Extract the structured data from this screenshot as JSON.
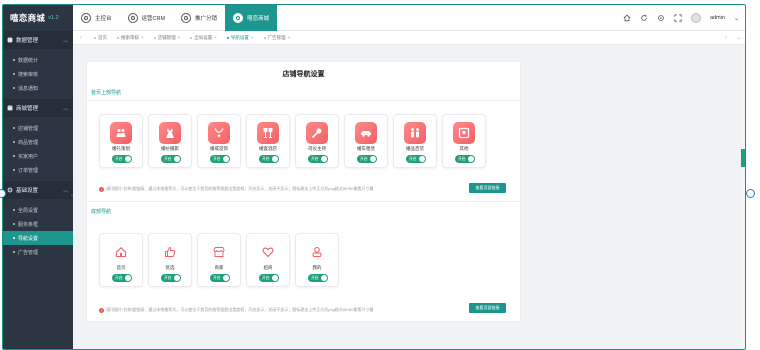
{
  "app": {
    "name": "嘻恋商城",
    "version": "v1.2"
  },
  "sidebar": {
    "groups": [
      {
        "label": "数据管理",
        "icon": "database-icon",
        "items": [
          "数据统计",
          "搜索审核",
          "消息通知"
        ]
      },
      {
        "label": "商城管理",
        "icon": "store-icon",
        "items": [
          "店铺管理",
          "商品管理",
          "买家用户",
          "订单管理"
        ]
      },
      {
        "label": "基础设置",
        "icon": "gear-icon",
        "items": [
          "全局设置",
          "服务条框",
          "导航设置",
          "广告管理"
        ]
      }
    ],
    "active_item": "导航设置"
  },
  "topbar": {
    "tabs": [
      {
        "label": "主控台",
        "active": false
      },
      {
        "label": "运营CRM",
        "active": false
      },
      {
        "label": "推广分销",
        "active": false
      },
      {
        "label": "嘻恋商城",
        "active": true
      }
    ],
    "icons": [
      "home-icon",
      "refresh-icon",
      "settings-icon",
      "fullscreen-icon"
    ],
    "user": "admin",
    "user_chevron": "⌄"
  },
  "crumbs": {
    "left_arrow": "‹",
    "right_arrow": "›",
    "more_arrow": "⌄",
    "items": [
      {
        "label": "首页",
        "active": false
      },
      {
        "label": "搜索审核",
        "active": false
      },
      {
        "label": "店铺管理",
        "active": false
      },
      {
        "label": "全局设置",
        "active": false
      },
      {
        "label": "导航设置",
        "active": true
      },
      {
        "label": "广告管理",
        "active": false
      }
    ]
  },
  "page": {
    "title": "店铺导航设置",
    "top_nav": {
      "title": "首页上部导航",
      "items": [
        {
          "label": "婚礼策划",
          "toggle": "开启",
          "icon": "couple-icon"
        },
        {
          "label": "婚纱摄影",
          "toggle": "开启",
          "icon": "dress-icon"
        },
        {
          "label": "婚戒首饰",
          "toggle": "开启",
          "icon": "necklace-icon"
        },
        {
          "label": "婚宴酒店",
          "toggle": "开启",
          "icon": "wine-glasses-icon"
        },
        {
          "label": "司仪主持",
          "toggle": "开启",
          "icon": "microphone-icon"
        },
        {
          "label": "婚车租赁",
          "toggle": "开启",
          "icon": "car-icon"
        },
        {
          "label": "婚品百货",
          "toggle": "开启",
          "icon": "family-icon"
        },
        {
          "label": "其他",
          "toggle": "开启",
          "icon": "photo-icon"
        }
      ],
      "tip": "通讯图片/名称/超链接、通过本地推荐式，可以使位于首页的推荐图超出宽度框，开启显示，关闭不显示；图标建议上传正方形png格式80*80像素尺寸最",
      "button": "查看页面链接"
    },
    "bottom_nav": {
      "title": "底部导航",
      "items": [
        {
          "label": "首页",
          "toggle": "开启",
          "icon": "house-icon"
        },
        {
          "label": "优选",
          "toggle": "开启",
          "icon": "thumbs-up-icon"
        },
        {
          "label": "商家",
          "toggle": "开启",
          "icon": "shop-icon"
        },
        {
          "label": "招商",
          "toggle": "开启",
          "icon": "heart-icon"
        },
        {
          "label": "我的",
          "toggle": "开启",
          "icon": "user-icon"
        }
      ],
      "tip": "通讯图片/名称/超链接、通过本地推荐式，可以使位于首页的推荐图超出宽度框，开启显示，关闭不显示；图标建议上传正方形png格式80*80像素尺寸最",
      "button": "查看页面链接"
    }
  },
  "colors": {
    "accent": "#1c968e",
    "sidebar": "#2c3542",
    "icon_gradient": "#f25f66",
    "toggle": "#1fa07a"
  }
}
